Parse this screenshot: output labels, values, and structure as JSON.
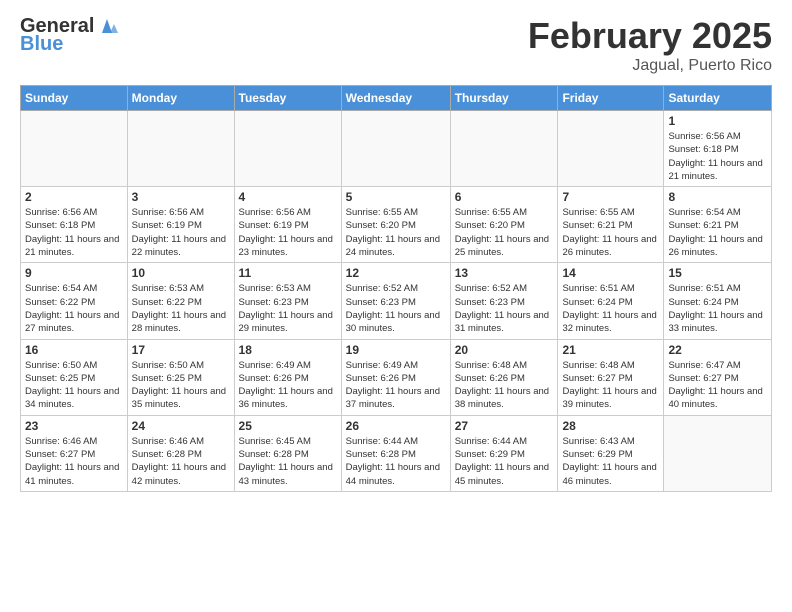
{
  "header": {
    "logo_general": "General",
    "logo_blue": "Blue",
    "title": "February 2025",
    "subtitle": "Jagual, Puerto Rico"
  },
  "weekdays": [
    "Sunday",
    "Monday",
    "Tuesday",
    "Wednesday",
    "Thursday",
    "Friday",
    "Saturday"
  ],
  "weeks": [
    [
      {
        "day": "",
        "info": ""
      },
      {
        "day": "",
        "info": ""
      },
      {
        "day": "",
        "info": ""
      },
      {
        "day": "",
        "info": ""
      },
      {
        "day": "",
        "info": ""
      },
      {
        "day": "",
        "info": ""
      },
      {
        "day": "1",
        "info": "Sunrise: 6:56 AM\nSunset: 6:18 PM\nDaylight: 11 hours and 21 minutes."
      }
    ],
    [
      {
        "day": "2",
        "info": "Sunrise: 6:56 AM\nSunset: 6:18 PM\nDaylight: 11 hours and 21 minutes."
      },
      {
        "day": "3",
        "info": "Sunrise: 6:56 AM\nSunset: 6:19 PM\nDaylight: 11 hours and 22 minutes."
      },
      {
        "day": "4",
        "info": "Sunrise: 6:56 AM\nSunset: 6:19 PM\nDaylight: 11 hours and 23 minutes."
      },
      {
        "day": "5",
        "info": "Sunrise: 6:55 AM\nSunset: 6:20 PM\nDaylight: 11 hours and 24 minutes."
      },
      {
        "day": "6",
        "info": "Sunrise: 6:55 AM\nSunset: 6:20 PM\nDaylight: 11 hours and 25 minutes."
      },
      {
        "day": "7",
        "info": "Sunrise: 6:55 AM\nSunset: 6:21 PM\nDaylight: 11 hours and 26 minutes."
      },
      {
        "day": "8",
        "info": "Sunrise: 6:54 AM\nSunset: 6:21 PM\nDaylight: 11 hours and 26 minutes."
      }
    ],
    [
      {
        "day": "9",
        "info": "Sunrise: 6:54 AM\nSunset: 6:22 PM\nDaylight: 11 hours and 27 minutes."
      },
      {
        "day": "10",
        "info": "Sunrise: 6:53 AM\nSunset: 6:22 PM\nDaylight: 11 hours and 28 minutes."
      },
      {
        "day": "11",
        "info": "Sunrise: 6:53 AM\nSunset: 6:23 PM\nDaylight: 11 hours and 29 minutes."
      },
      {
        "day": "12",
        "info": "Sunrise: 6:52 AM\nSunset: 6:23 PM\nDaylight: 11 hours and 30 minutes."
      },
      {
        "day": "13",
        "info": "Sunrise: 6:52 AM\nSunset: 6:23 PM\nDaylight: 11 hours and 31 minutes."
      },
      {
        "day": "14",
        "info": "Sunrise: 6:51 AM\nSunset: 6:24 PM\nDaylight: 11 hours and 32 minutes."
      },
      {
        "day": "15",
        "info": "Sunrise: 6:51 AM\nSunset: 6:24 PM\nDaylight: 11 hours and 33 minutes."
      }
    ],
    [
      {
        "day": "16",
        "info": "Sunrise: 6:50 AM\nSunset: 6:25 PM\nDaylight: 11 hours and 34 minutes."
      },
      {
        "day": "17",
        "info": "Sunrise: 6:50 AM\nSunset: 6:25 PM\nDaylight: 11 hours and 35 minutes."
      },
      {
        "day": "18",
        "info": "Sunrise: 6:49 AM\nSunset: 6:26 PM\nDaylight: 11 hours and 36 minutes."
      },
      {
        "day": "19",
        "info": "Sunrise: 6:49 AM\nSunset: 6:26 PM\nDaylight: 11 hours and 37 minutes."
      },
      {
        "day": "20",
        "info": "Sunrise: 6:48 AM\nSunset: 6:26 PM\nDaylight: 11 hours and 38 minutes."
      },
      {
        "day": "21",
        "info": "Sunrise: 6:48 AM\nSunset: 6:27 PM\nDaylight: 11 hours and 39 minutes."
      },
      {
        "day": "22",
        "info": "Sunrise: 6:47 AM\nSunset: 6:27 PM\nDaylight: 11 hours and 40 minutes."
      }
    ],
    [
      {
        "day": "23",
        "info": "Sunrise: 6:46 AM\nSunset: 6:27 PM\nDaylight: 11 hours and 41 minutes."
      },
      {
        "day": "24",
        "info": "Sunrise: 6:46 AM\nSunset: 6:28 PM\nDaylight: 11 hours and 42 minutes."
      },
      {
        "day": "25",
        "info": "Sunrise: 6:45 AM\nSunset: 6:28 PM\nDaylight: 11 hours and 43 minutes."
      },
      {
        "day": "26",
        "info": "Sunrise: 6:44 AM\nSunset: 6:28 PM\nDaylight: 11 hours and 44 minutes."
      },
      {
        "day": "27",
        "info": "Sunrise: 6:44 AM\nSunset: 6:29 PM\nDaylight: 11 hours and 45 minutes."
      },
      {
        "day": "28",
        "info": "Sunrise: 6:43 AM\nSunset: 6:29 PM\nDaylight: 11 hours and 46 minutes."
      },
      {
        "day": "",
        "info": ""
      }
    ]
  ]
}
